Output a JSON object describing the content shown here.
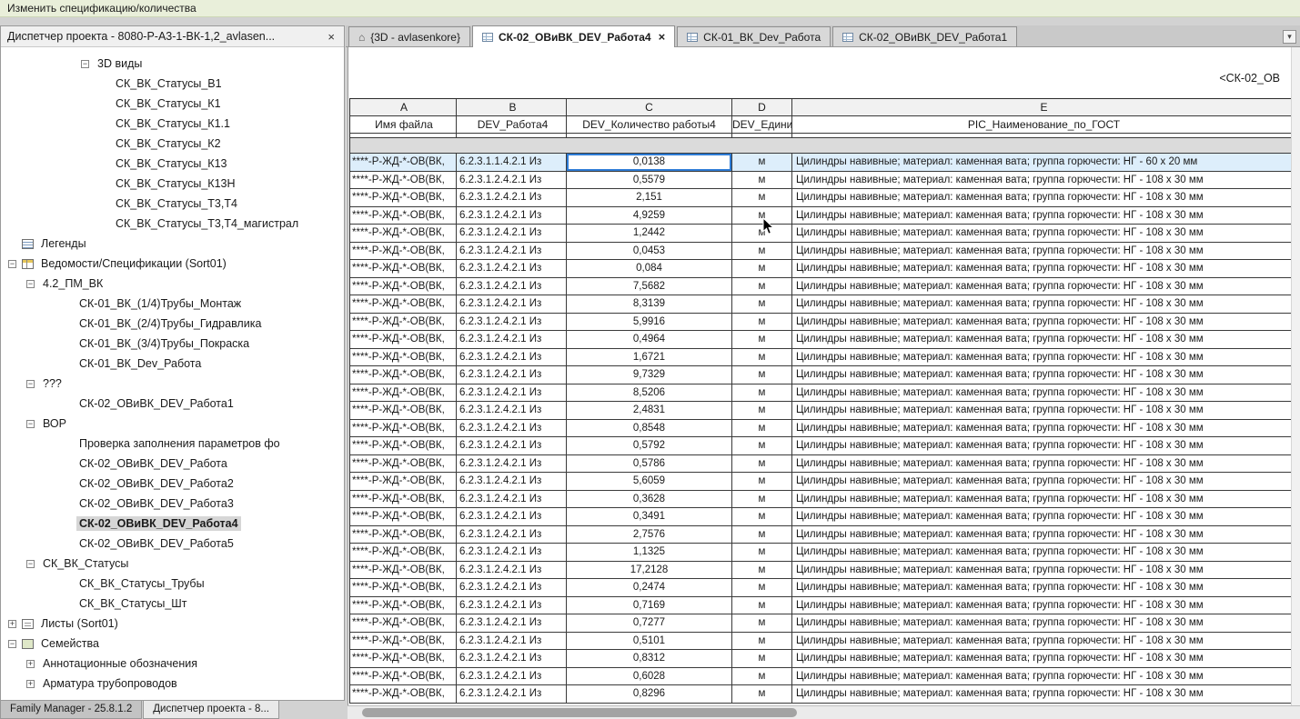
{
  "topbar": {
    "title": "Изменить спецификацию/количества"
  },
  "browser": {
    "title": "Диспетчер проекта - 8080-Р-А3-1-ВК-1,2_avlasen...",
    "close_glyph": "×",
    "tree": [
      {
        "label": "3D виды",
        "level": 4,
        "marker": "minus",
        "icon": null,
        "selected": false
      },
      {
        "label": "СК_ВК_Статусы_В1",
        "level": 5,
        "marker": "none",
        "icon": null,
        "selected": false
      },
      {
        "label": "СК_ВК_Статусы_К1",
        "level": 5,
        "marker": "none",
        "icon": null,
        "selected": false
      },
      {
        "label": "СК_ВК_Статусы_К1.1",
        "level": 5,
        "marker": "none",
        "icon": null,
        "selected": false
      },
      {
        "label": "СК_ВК_Статусы_К2",
        "level": 5,
        "marker": "none",
        "icon": null,
        "selected": false
      },
      {
        "label": "СК_ВК_Статусы_К13",
        "level": 5,
        "marker": "none",
        "icon": null,
        "selected": false
      },
      {
        "label": "СК_ВК_Статусы_К13Н",
        "level": 5,
        "marker": "none",
        "icon": null,
        "selected": false
      },
      {
        "label": "СК_ВК_Статусы_Т3,Т4",
        "level": 5,
        "marker": "none",
        "icon": null,
        "selected": false
      },
      {
        "label": "СК_ВК_Статусы_Т3,Т4_магистрал",
        "level": 5,
        "marker": "none",
        "icon": null,
        "selected": false
      },
      {
        "label": "Легенды",
        "level": 0,
        "marker": "none",
        "icon": "legend",
        "selected": false
      },
      {
        "label": "Ведомости/Спецификации (Sort01)",
        "level": 0,
        "marker": "minus",
        "icon": "schedule",
        "selected": false
      },
      {
        "label": "4.2_ПМ_ВК",
        "level": 1,
        "marker": "minus",
        "icon": null,
        "selected": false
      },
      {
        "label": "СК-01_ВК_(1/4)Трубы_Монтаж",
        "level": 3,
        "marker": "none",
        "icon": null,
        "selected": false
      },
      {
        "label": "СК-01_ВК_(2/4)Трубы_Гидравлика",
        "level": 3,
        "marker": "none",
        "icon": null,
        "selected": false
      },
      {
        "label": "СК-01_ВК_(3/4)Трубы_Покраска",
        "level": 3,
        "marker": "none",
        "icon": null,
        "selected": false
      },
      {
        "label": "СК-01_ВК_Dev_Работа",
        "level": 3,
        "marker": "none",
        "icon": null,
        "selected": false
      },
      {
        "label": "???",
        "level": 1,
        "marker": "minus",
        "icon": null,
        "selected": false
      },
      {
        "label": "СК-02_ОВиВК_DEV_Работа1",
        "level": 3,
        "marker": "none",
        "icon": null,
        "selected": false
      },
      {
        "label": "ВОР",
        "level": 1,
        "marker": "minus",
        "icon": null,
        "selected": false
      },
      {
        "label": "Проверка заполнения параметров фо",
        "level": 3,
        "marker": "none",
        "icon": null,
        "selected": false
      },
      {
        "label": "СК-02_ОВиВК_DEV_Работа",
        "level": 3,
        "marker": "none",
        "icon": null,
        "selected": false
      },
      {
        "label": "СК-02_ОВиВК_DEV_Работа2",
        "level": 3,
        "marker": "none",
        "icon": null,
        "selected": false
      },
      {
        "label": "СК-02_ОВиВК_DEV_Работа3",
        "level": 3,
        "marker": "none",
        "icon": null,
        "selected": false
      },
      {
        "label": "СК-02_ОВиВК_DEV_Работа4",
        "level": 3,
        "marker": "none",
        "icon": null,
        "selected": true
      },
      {
        "label": "СК-02_ОВиВК_DEV_Работа5",
        "level": 3,
        "marker": "none",
        "icon": null,
        "selected": false
      },
      {
        "label": "СК_ВК_Статусы",
        "level": 1,
        "marker": "minus",
        "icon": null,
        "selected": false
      },
      {
        "label": "СК_ВК_Статусы_Трубы",
        "level": 3,
        "marker": "none",
        "icon": null,
        "selected": false
      },
      {
        "label": "СК_ВК_Статусы_Шт",
        "level": 3,
        "marker": "none",
        "icon": null,
        "selected": false
      },
      {
        "label": "Листы (Sort01)",
        "level": 0,
        "marker": "plus",
        "icon": "sheet",
        "selected": false
      },
      {
        "label": "Семейства",
        "level": 0,
        "marker": "minus",
        "icon": "family",
        "selected": false
      },
      {
        "label": "Аннотационные обозначения",
        "level": 1,
        "marker": "plus",
        "icon": null,
        "selected": false
      },
      {
        "label": "Арматура трубопроводов",
        "level": 1,
        "marker": "plus",
        "icon": null,
        "selected": false
      }
    ],
    "bottom_tabs": [
      {
        "label": "Family Manager - 25.8.1.2",
        "active": false
      },
      {
        "label": "Диспетчер проекта - 8...",
        "active": true
      }
    ]
  },
  "view_tabs": [
    {
      "label": "{3D - avlasenkore}",
      "icon": "3d",
      "active": false,
      "closable": false
    },
    {
      "label": "СК-02_ОВиВК_DEV_Работа4",
      "icon": "schedule",
      "active": true,
      "closable": true
    },
    {
      "label": "СК-01_ВК_Dev_Работа",
      "icon": "schedule",
      "active": false,
      "closable": false
    },
    {
      "label": "СК-02_ОВиВК_DEV_Работа1",
      "icon": "schedule",
      "active": false,
      "closable": false
    }
  ],
  "schedule": {
    "title": "<СК-02_ОВ",
    "col_letters": [
      "A",
      "B",
      "C",
      "D",
      "E"
    ],
    "col_headers": [
      "Имя файла",
      "DEV_Работа4",
      "DEV_Количество работы4",
      "DEV_Едини",
      "PIC_Наименование_по_ГОСТ"
    ],
    "rows": [
      {
        "a": "****-Р-ЖД-*-ОВ(ВК,",
        "b": "6.2.3.1.1.4.2.1 Из",
        "c": "0,0138",
        "d": "м",
        "e": "Цилиндры навивные; материал: каменная вата; группа горючести: НГ - 60 x 20 мм",
        "selected": true
      },
      {
        "a": "****-Р-ЖД-*-ОВ(ВК,",
        "b": "6.2.3.1.2.4.2.1 Из",
        "c": "0,5579",
        "d": "м",
        "e": "Цилиндры навивные; материал: каменная вата; группа горючести: НГ - 108 x 30 мм",
        "selected": false
      },
      {
        "a": "****-Р-ЖД-*-ОВ(ВК,",
        "b": "6.2.3.1.2.4.2.1 Из",
        "c": "2,151",
        "d": "м",
        "e": "Цилиндры навивные; материал: каменная вата; группа горючести: НГ - 108 x 30 мм",
        "selected": false
      },
      {
        "a": "****-Р-ЖД-*-ОВ(ВК,",
        "b": "6.2.3.1.2.4.2.1 Из",
        "c": "4,9259",
        "d": "м",
        "e": "Цилиндры навивные; материал: каменная вата; группа горючести: НГ - 108 x 30 мм",
        "selected": false
      },
      {
        "a": "****-Р-ЖД-*-ОВ(ВК,",
        "b": "6.2.3.1.2.4.2.1 Из",
        "c": "1,2442",
        "d": "м",
        "e": "Цилиндры навивные; материал: каменная вата; группа горючести: НГ - 108 x 30 мм",
        "selected": false
      },
      {
        "a": "****-Р-ЖД-*-ОВ(ВК,",
        "b": "6.2.3.1.2.4.2.1 Из",
        "c": "0,0453",
        "d": "м",
        "e": "Цилиндры навивные; материал: каменная вата; группа горючести: НГ - 108 x 30 мм",
        "selected": false
      },
      {
        "a": "****-Р-ЖД-*-ОВ(ВК,",
        "b": "6.2.3.1.2.4.2.1 Из",
        "c": "0,084",
        "d": "м",
        "e": "Цилиндры навивные; материал: каменная вата; группа горючести: НГ - 108 x 30 мм",
        "selected": false
      },
      {
        "a": "****-Р-ЖД-*-ОВ(ВК,",
        "b": "6.2.3.1.2.4.2.1 Из",
        "c": "7,5682",
        "d": "м",
        "e": "Цилиндры навивные; материал: каменная вата; группа горючести: НГ - 108 x 30 мм",
        "selected": false
      },
      {
        "a": "****-Р-ЖД-*-ОВ(ВК,",
        "b": "6.2.3.1.2.4.2.1 Из",
        "c": "8,3139",
        "d": "м",
        "e": "Цилиндры навивные; материал: каменная вата; группа горючести: НГ - 108 x 30 мм",
        "selected": false
      },
      {
        "a": "****-Р-ЖД-*-ОВ(ВК,",
        "b": "6.2.3.1.2.4.2.1 Из",
        "c": "5,9916",
        "d": "м",
        "e": "Цилиндры навивные; материал: каменная вата; группа горючести: НГ - 108 x 30 мм",
        "selected": false
      },
      {
        "a": "****-Р-ЖД-*-ОВ(ВК,",
        "b": "6.2.3.1.2.4.2.1 Из",
        "c": "0,4964",
        "d": "м",
        "e": "Цилиндры навивные; материал: каменная вата; группа горючести: НГ - 108 x 30 мм",
        "selected": false
      },
      {
        "a": "****-Р-ЖД-*-ОВ(ВК,",
        "b": "6.2.3.1.2.4.2.1 Из",
        "c": "1,6721",
        "d": "м",
        "e": "Цилиндры навивные; материал: каменная вата; группа горючести: НГ - 108 x 30 мм",
        "selected": false
      },
      {
        "a": "****-Р-ЖД-*-ОВ(ВК,",
        "b": "6.2.3.1.2.4.2.1 Из",
        "c": "9,7329",
        "d": "м",
        "e": "Цилиндры навивные; материал: каменная вата; группа горючести: НГ - 108 x 30 мм",
        "selected": false
      },
      {
        "a": "****-Р-ЖД-*-ОВ(ВК,",
        "b": "6.2.3.1.2.4.2.1 Из",
        "c": "8,5206",
        "d": "м",
        "e": "Цилиндры навивные; материал: каменная вата; группа горючести: НГ - 108 x 30 мм",
        "selected": false
      },
      {
        "a": "****-Р-ЖД-*-ОВ(ВК,",
        "b": "6.2.3.1.2.4.2.1 Из",
        "c": "2,4831",
        "d": "м",
        "e": "Цилиндры навивные; материал: каменная вата; группа горючести: НГ - 108 x 30 мм",
        "selected": false
      },
      {
        "a": "****-Р-ЖД-*-ОВ(ВК,",
        "b": "6.2.3.1.2.4.2.1 Из",
        "c": "0,8548",
        "d": "м",
        "e": "Цилиндры навивные; материал: каменная вата; группа горючести: НГ - 108 x 30 мм",
        "selected": false
      },
      {
        "a": "****-Р-ЖД-*-ОВ(ВК,",
        "b": "6.2.3.1.2.4.2.1 Из",
        "c": "0,5792",
        "d": "м",
        "e": "Цилиндры навивные; материал: каменная вата; группа горючести: НГ - 108 x 30 мм",
        "selected": false
      },
      {
        "a": "****-Р-ЖД-*-ОВ(ВК,",
        "b": "6.2.3.1.2.4.2.1 Из",
        "c": "0,5786",
        "d": "м",
        "e": "Цилиндры навивные; материал: каменная вата; группа горючести: НГ - 108 x 30 мм",
        "selected": false
      },
      {
        "a": "****-Р-ЖД-*-ОВ(ВК,",
        "b": "6.2.3.1.2.4.2.1 Из",
        "c": "5,6059",
        "d": "м",
        "e": "Цилиндры навивные; материал: каменная вата; группа горючести: НГ - 108 x 30 мм",
        "selected": false
      },
      {
        "a": "****-Р-ЖД-*-ОВ(ВК,",
        "b": "6.2.3.1.2.4.2.1 Из",
        "c": "0,3628",
        "d": "м",
        "e": "Цилиндры навивные; материал: каменная вата; группа горючести: НГ - 108 x 30 мм",
        "selected": false
      },
      {
        "a": "****-Р-ЖД-*-ОВ(ВК,",
        "b": "6.2.3.1.2.4.2.1 Из",
        "c": "0,3491",
        "d": "м",
        "e": "Цилиндры навивные; материал: каменная вата; группа горючести: НГ - 108 x 30 мм",
        "selected": false
      },
      {
        "a": "****-Р-ЖД-*-ОВ(ВК,",
        "b": "6.2.3.1.2.4.2.1 Из",
        "c": "2,7576",
        "d": "м",
        "e": "Цилиндры навивные; материал: каменная вата; группа горючести: НГ - 108 x 30 мм",
        "selected": false
      },
      {
        "a": "****-Р-ЖД-*-ОВ(ВК,",
        "b": "6.2.3.1.2.4.2.1 Из",
        "c": "1,1325",
        "d": "м",
        "e": "Цилиндры навивные; материал: каменная вата; группа горючести: НГ - 108 x 30 мм",
        "selected": false
      },
      {
        "a": "****-Р-ЖД-*-ОВ(ВК,",
        "b": "6.2.3.1.2.4.2.1 Из",
        "c": "17,2128",
        "d": "м",
        "e": "Цилиндры навивные; материал: каменная вата; группа горючести: НГ - 108 x 30 мм",
        "selected": false
      },
      {
        "a": "****-Р-ЖД-*-ОВ(ВК,",
        "b": "6.2.3.1.2.4.2.1 Из",
        "c": "0,2474",
        "d": "м",
        "e": "Цилиндры навивные; материал: каменная вата; группа горючести: НГ - 108 x 30 мм",
        "selected": false
      },
      {
        "a": "****-Р-ЖД-*-ОВ(ВК,",
        "b": "6.2.3.1.2.4.2.1 Из",
        "c": "0,7169",
        "d": "м",
        "e": "Цилиндры навивные; материал: каменная вата; группа горючести: НГ - 108 x 30 мм",
        "selected": false
      },
      {
        "a": "****-Р-ЖД-*-ОВ(ВК,",
        "b": "6.2.3.1.2.4.2.1 Из",
        "c": "0,7277",
        "d": "м",
        "e": "Цилиндры навивные; материал: каменная вата; группа горючести: НГ - 108 x 30 мм",
        "selected": false
      },
      {
        "a": "****-Р-ЖД-*-ОВ(ВК,",
        "b": "6.2.3.1.2.4.2.1 Из",
        "c": "0,5101",
        "d": "м",
        "e": "Цилиндры навивные; материал: каменная вата; группа горючести: НГ - 108 x 30 мм",
        "selected": false
      },
      {
        "a": "****-Р-ЖД-*-ОВ(ВК,",
        "b": "6.2.3.1.2.4.2.1 Из",
        "c": "0,8312",
        "d": "м",
        "e": "Цилиндры навивные; материал: каменная вата; группа горючести: НГ - 108 x 30 мм",
        "selected": false
      },
      {
        "a": "****-Р-ЖД-*-ОВ(ВК,",
        "b": "6.2.3.1.2.4.2.1 Из",
        "c": "0,6028",
        "d": "м",
        "e": "Цилиндры навивные; материал: каменная вата; группа горючести: НГ - 108 x 30 мм",
        "selected": false
      },
      {
        "a": "****-Р-ЖД-*-ОВ(ВК,",
        "b": "6.2.3.1.2.4.2.1 Из",
        "c": "0,8296",
        "d": "м",
        "e": "Цилиндры навивные; материал: каменная вата; группа горючести: НГ - 108 x 30 мм",
        "selected": false
      }
    ]
  },
  "colors": {
    "topbar_bg": "#e9efda",
    "selected_row_bg": "#ddeefb",
    "selected_cell_border": "#2e7cd6",
    "group_band_bg": "#dbdbdb"
  }
}
